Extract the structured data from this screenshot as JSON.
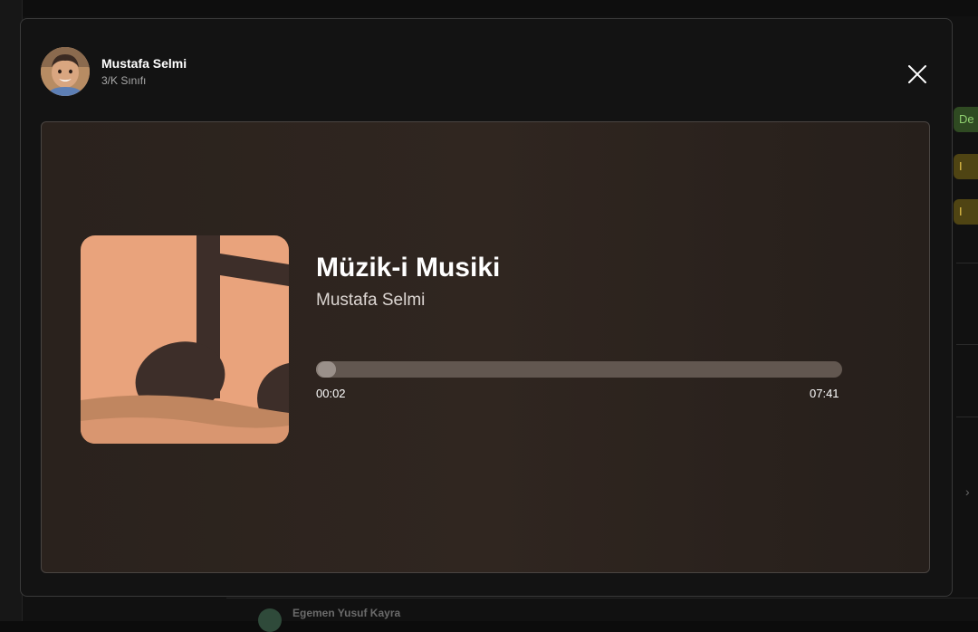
{
  "background": {
    "bottom_row_name": "Egemen Yusuf Kayra",
    "tags": [
      "De",
      "I",
      "I"
    ],
    "chevron": "›"
  },
  "user": {
    "name": "Mustafa Selmi",
    "class": "3/K Sınıfı",
    "avatar": "student-avatar-photo"
  },
  "player": {
    "title": "Müzik-i Musiki",
    "artist": "Mustafa Selmi",
    "current_time": "00:02",
    "total_time": "07:41",
    "progress": 0.004,
    "cover_icon": "music-note-icon"
  },
  "colors": {
    "cover_background": "#e9a37c",
    "cover_note": "#3d2e29",
    "cover_wave": "#c08660",
    "progress_track": "#625750",
    "progress_knob": "#9a908a",
    "modal_border": "#3a3a3a"
  },
  "close_icon": "close-icon"
}
